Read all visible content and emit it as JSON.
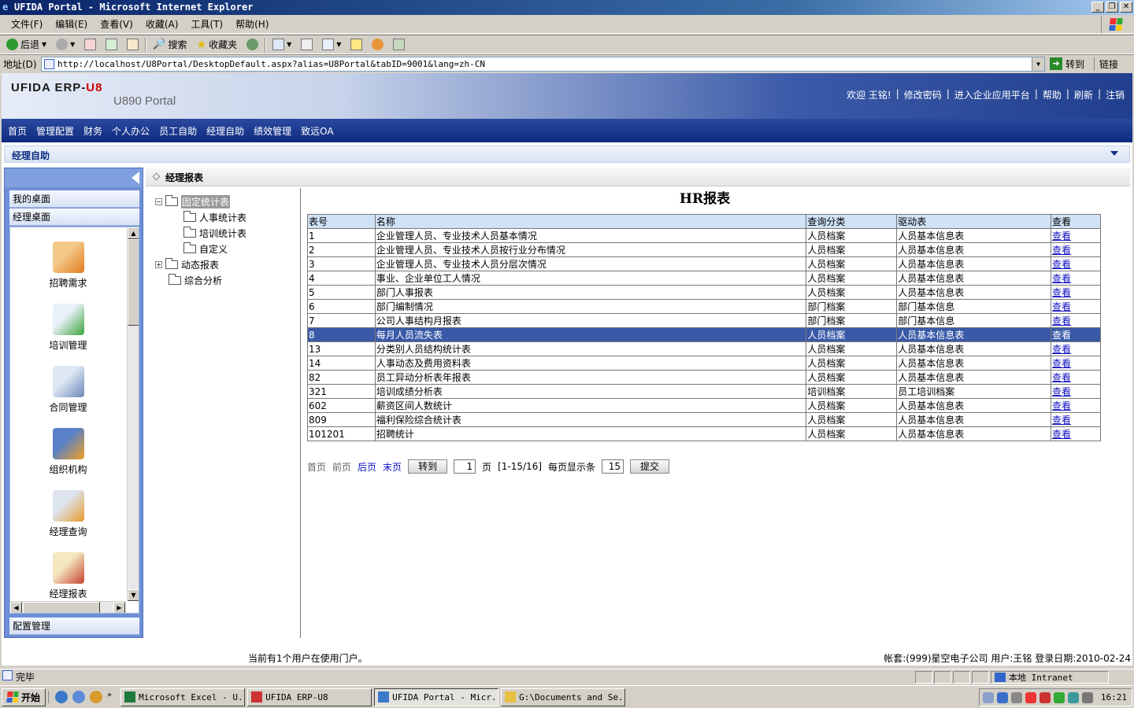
{
  "window": {
    "title": "UFIDA Portal - Microsoft Internet Explorer"
  },
  "menu": [
    "文件(F)",
    "编辑(E)",
    "查看(V)",
    "收藏(A)",
    "工具(T)",
    "帮助(H)"
  ],
  "toolbar": {
    "back": "后退",
    "search": "搜索",
    "favorites": "收藏夹"
  },
  "address": {
    "label": "地址(D)",
    "url": "http://localhost/U8Portal/DesktopDefault.aspx?alias=U8Portal&tabID=9001&lang=zh-CN",
    "go": "转到",
    "links": "链接"
  },
  "portal": {
    "logo_main": "UFIDA ERP-",
    "logo_accent": "U8",
    "subtitle": "U890 Portal",
    "header_links": [
      "欢迎 王铭!",
      "修改密码",
      "进入企业应用平台",
      "帮助",
      "刷新",
      "注销"
    ],
    "nav": [
      "首页",
      "管理配置",
      "财务",
      "个人办公",
      "员工自助",
      "经理自助",
      "绩效管理",
      "致远OA"
    ],
    "breadcrumb": "经理自助"
  },
  "left_panel": {
    "items_top": [
      "我的桌面",
      "经理桌面"
    ],
    "item_bottom": "配置管理",
    "icons": [
      "招聘需求",
      "培训管理",
      "合同管理",
      "组织机构",
      "经理查询",
      "经理报表"
    ]
  },
  "section": {
    "title": "经理报表"
  },
  "tree": {
    "root_fixed": "固定统计表",
    "children": [
      "人事统计表",
      "培训统计表",
      "自定义"
    ],
    "dynamic": "动态报表",
    "analysis": "综合分析"
  },
  "report": {
    "title": "HR报表",
    "columns": [
      "表号",
      "名称",
      "查询分类",
      "驱动表",
      "查看"
    ],
    "rows": [
      [
        "1",
        "企业管理人员、专业技术人员基本情况",
        "人员档案",
        "人员基本信息表",
        "查看"
      ],
      [
        "2",
        "企业管理人员、专业技术人员按行业分布情况",
        "人员档案",
        "人员基本信息表",
        "查看"
      ],
      [
        "3",
        "企业管理人员、专业技术人员分层次情况",
        "人员档案",
        "人员基本信息表",
        "查看"
      ],
      [
        "4",
        "事业、企业单位工人情况",
        "人员档案",
        "人员基本信息表",
        "查看"
      ],
      [
        "5",
        "部门人事报表",
        "人员档案",
        "人员基本信息表",
        "查看"
      ],
      [
        "6",
        "部门编制情况",
        "部门档案",
        "部门基本信息",
        "查看"
      ],
      [
        "7",
        "公司人事结构月报表",
        "部门档案",
        "部门基本信息",
        "查看"
      ],
      [
        "8",
        "每月人员流失表",
        "人员档案",
        "人员基本信息表",
        "查看"
      ],
      [
        "13",
        "分类别人员结构统计表",
        "人员档案",
        "人员基本信息表",
        "查看"
      ],
      [
        "14",
        "人事动态及费用资料表",
        "人员档案",
        "人员基本信息表",
        "查看"
      ],
      [
        "82",
        "员工异动分析表年报表",
        "人员档案",
        "人员基本信息表",
        "查看"
      ],
      [
        "321",
        "培训成绩分析表",
        "培训档案",
        "员工培训档案",
        "查看"
      ],
      [
        "602",
        "薪资区间人数统计",
        "人员档案",
        "人员基本信息表",
        "查看"
      ],
      [
        "809",
        "福利保险综合统计表",
        "人员档案",
        "人员基本信息表",
        "查看"
      ],
      [
        "101201",
        "招聘统计",
        "人员档案",
        "人员基本信息表",
        "查看"
      ]
    ],
    "highlighted_row_no": "8"
  },
  "pager": {
    "first": "首页",
    "prev": "前页",
    "next": "后页",
    "last": "末页",
    "goto": "转到",
    "page_value": "1",
    "page_suffix": "页",
    "range": "[1-15/16]",
    "per_page_label": "每页显示条",
    "per_page_value": "15",
    "submit": "提交"
  },
  "footer": {
    "users": "当前有1个用户在使用门户。",
    "account": "帐套:(999)星空电子公司 用户:王铭 登录日期:2010-02-24"
  },
  "status": {
    "text": "完毕",
    "zone": "本地 Intranet"
  },
  "taskbar": {
    "start": "开始",
    "tasks": [
      "Microsoft Excel - U...",
      "UFIDA ERP-U8",
      "UFIDA Portal - Micr...",
      "G:\\Documents and Se..."
    ],
    "active_index": 2,
    "clock": "16:21"
  }
}
